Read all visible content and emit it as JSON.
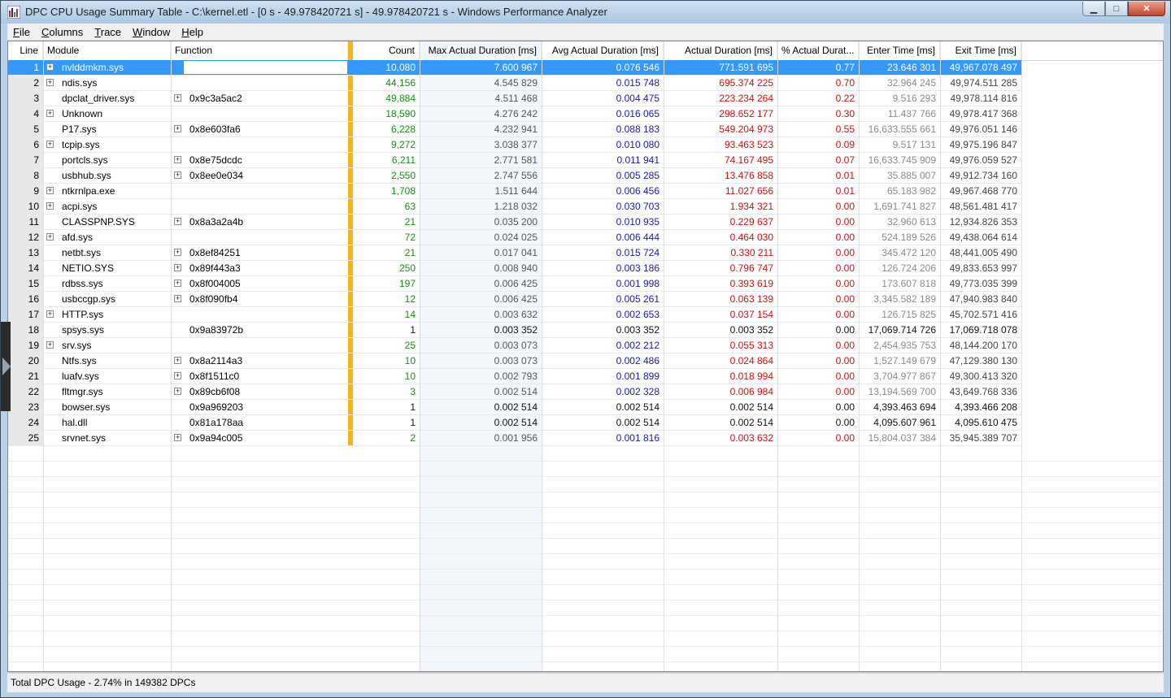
{
  "window": {
    "title": "DPC CPU Usage Summary Table - C:\\kernel.etl - [0 s - 49.978420721 s] - 49.978420721 s - Windows Performance Analyzer",
    "minimize_label": "▁",
    "maximize_label": "□",
    "close_label": "✕"
  },
  "menu": [
    {
      "label": "File",
      "accel": "F",
      "rest": "ile"
    },
    {
      "label": "Columns",
      "accel": "C",
      "rest": "olumns"
    },
    {
      "label": "Trace",
      "accel": "T",
      "rest": "race"
    },
    {
      "label": "Window",
      "accel": "W",
      "rest": "indow"
    },
    {
      "label": "Help",
      "accel": "H",
      "rest": "elp"
    }
  ],
  "columns": {
    "line": "Line",
    "module": "Module",
    "function": "Function",
    "count": "Count",
    "max": "Max Actual Duration [ms]",
    "avg": "Avg Actual Duration [ms]",
    "actual": "Actual Duration [ms]",
    "pct": "% Actual Durat...",
    "enter": "Enter Time [ms]",
    "exit": "Exit Time [ms]"
  },
  "rows": [
    {
      "line": "1",
      "module": "nvlddmkm.sys",
      "mexp": true,
      "func": "",
      "fexp": false,
      "count": "10,080",
      "max": "7.600 967",
      "avg": "0.076 546",
      "actual": "771.591 695",
      "pct": "0.77",
      "enter": "23.646 301",
      "exit": "49,967.078 497",
      "selected": true
    },
    {
      "line": "2",
      "module": "ndis.sys",
      "mexp": true,
      "func": "",
      "fexp": false,
      "count": "44,156",
      "max": "4.545 829",
      "avg": "0.015 748",
      "actual": "695.374 225",
      "pct": "0.70",
      "enter": "32.964 245",
      "exit": "49,974.511 285"
    },
    {
      "line": "3",
      "module": "dpclat_driver.sys",
      "mexp": false,
      "func": "0x9c3a5ac2",
      "fexp": true,
      "count": "49,884",
      "max": "4.511 468",
      "avg": "0.004 475",
      "actual": "223.234 264",
      "pct": "0.22",
      "enter": "9.516 293",
      "exit": "49,978.114 816"
    },
    {
      "line": "4",
      "module": "Unknown",
      "mexp": true,
      "func": "",
      "fexp": false,
      "count": "18,590",
      "max": "4.276 242",
      "avg": "0.016 065",
      "actual": "298.652 177",
      "pct": "0.30",
      "enter": "11.437 766",
      "exit": "49,978.417 368"
    },
    {
      "line": "5",
      "module": "P17.sys",
      "mexp": false,
      "func": "0x8e603fa6",
      "fexp": true,
      "count": "6,228",
      "max": "4.232 941",
      "avg": "0.088 183",
      "actual": "549.204 973",
      "pct": "0.55",
      "enter": "16,633.555 661",
      "exit": "49,976.051 146"
    },
    {
      "line": "6",
      "module": "tcpip.sys",
      "mexp": true,
      "func": "",
      "fexp": false,
      "count": "9,272",
      "max": "3.038 377",
      "avg": "0.010 080",
      "actual": "93.463 523",
      "pct": "0.09",
      "enter": "9.517 131",
      "exit": "49,975.196 847"
    },
    {
      "line": "7",
      "module": "portcls.sys",
      "mexp": false,
      "func": "0x8e75dcdc",
      "fexp": true,
      "count": "6,211",
      "max": "2.771 581",
      "avg": "0.011 941",
      "actual": "74.167 495",
      "pct": "0.07",
      "enter": "16,633.745 909",
      "exit": "49,976.059 527"
    },
    {
      "line": "8",
      "module": "usbhub.sys",
      "mexp": false,
      "func": "0x8ee0e034",
      "fexp": true,
      "count": "2,550",
      "max": "2.747 556",
      "avg": "0.005 285",
      "actual": "13.476 858",
      "pct": "0.01",
      "enter": "35.885 007",
      "exit": "49,912.734 160"
    },
    {
      "line": "9",
      "module": "ntkrnlpa.exe",
      "mexp": true,
      "func": "",
      "fexp": false,
      "count": "1,708",
      "max": "1.511 644",
      "avg": "0.006 456",
      "actual": "11.027 656",
      "pct": "0.01",
      "enter": "65.183 982",
      "exit": "49,967.468 770"
    },
    {
      "line": "10",
      "module": "acpi.sys",
      "mexp": true,
      "func": "",
      "fexp": false,
      "count": "63",
      "max": "1.218 032",
      "avg": "0.030 703",
      "actual": "1.934 321",
      "pct": "0.00",
      "enter": "1,691.741 827",
      "exit": "48,561.481 417"
    },
    {
      "line": "11",
      "module": "CLASSPNP.SYS",
      "mexp": false,
      "func": "0x8a3a2a4b",
      "fexp": true,
      "count": "21",
      "max": "0.035 200",
      "avg": "0.010 935",
      "actual": "0.229 637",
      "pct": "0.00",
      "enter": "32.960 613",
      "exit": "12,934.826 353"
    },
    {
      "line": "12",
      "module": "afd.sys",
      "mexp": true,
      "func": "",
      "fexp": false,
      "count": "72",
      "max": "0.024 025",
      "avg": "0.006 444",
      "actual": "0.464 030",
      "pct": "0.00",
      "enter": "524.189 526",
      "exit": "49,438.064 614"
    },
    {
      "line": "13",
      "module": "netbt.sys",
      "mexp": false,
      "func": "0x8ef84251",
      "fexp": true,
      "count": "21",
      "max": "0.017 041",
      "avg": "0.015 724",
      "actual": "0.330 211",
      "pct": "0.00",
      "enter": "345.472 120",
      "exit": "48,441.005 490"
    },
    {
      "line": "14",
      "module": "NETIO.SYS",
      "mexp": false,
      "func": "0x89f443a3",
      "fexp": true,
      "count": "250",
      "max": "0.008 940",
      "avg": "0.003 186",
      "actual": "0.796 747",
      "pct": "0.00",
      "enter": "126.724 206",
      "exit": "49,833.653 997"
    },
    {
      "line": "15",
      "module": "rdbss.sys",
      "mexp": false,
      "func": "0x8f004005",
      "fexp": true,
      "count": "197",
      "max": "0.006 425",
      "avg": "0.001 998",
      "actual": "0.393 619",
      "pct": "0.00",
      "enter": "173.607 818",
      "exit": "49,773.035 399"
    },
    {
      "line": "16",
      "module": "usbccgp.sys",
      "mexp": false,
      "func": "0x8f090fb4",
      "fexp": true,
      "count": "12",
      "max": "0.006 425",
      "avg": "0.005 261",
      "actual": "0.063 139",
      "pct": "0.00",
      "enter": "3,345.582 189",
      "exit": "47,940.983 840"
    },
    {
      "line": "17",
      "module": "HTTP.sys",
      "mexp": true,
      "func": "",
      "fexp": false,
      "count": "14",
      "max": "0.003 632",
      "avg": "0.002 653",
      "actual": "0.037 154",
      "pct": "0.00",
      "enter": "126.715 825",
      "exit": "45,702.571 416"
    },
    {
      "line": "18",
      "module": "spsys.sys",
      "mexp": false,
      "func": "0x9a83972b",
      "fexp": false,
      "count": "1",
      "max": "0.003 352",
      "avg": "0.003 352",
      "actual": "0.003 352",
      "pct": "0.00",
      "enter": "17,069.714 726",
      "exit": "17,069.718 078",
      "single": true
    },
    {
      "line": "19",
      "module": "srv.sys",
      "mexp": true,
      "func": "",
      "fexp": false,
      "count": "25",
      "max": "0.003 073",
      "avg": "0.002 212",
      "actual": "0.055 313",
      "pct": "0.00",
      "enter": "2,454.935 753",
      "exit": "48,144.200 170"
    },
    {
      "line": "20",
      "module": "Ntfs.sys",
      "mexp": false,
      "func": "0x8a2114a3",
      "fexp": true,
      "count": "10",
      "max": "0.003 073",
      "avg": "0.002 486",
      "actual": "0.024 864",
      "pct": "0.00",
      "enter": "1,527.149 679",
      "exit": "47,129.380 130"
    },
    {
      "line": "21",
      "module": "luafv.sys",
      "mexp": false,
      "func": "0x8f1511c0",
      "fexp": true,
      "count": "10",
      "max": "0.002 793",
      "avg": "0.001 899",
      "actual": "0.018 994",
      "pct": "0.00",
      "enter": "3,704.977 867",
      "exit": "49,300.413 320"
    },
    {
      "line": "22",
      "module": "fltmgr.sys",
      "mexp": false,
      "func": "0x89cb6f08",
      "fexp": true,
      "count": "3",
      "max": "0.002 514",
      "avg": "0.002 328",
      "actual": "0.006 984",
      "pct": "0.00",
      "enter": "13,194.569 700",
      "exit": "43,649.768 336"
    },
    {
      "line": "23",
      "module": "bowser.sys",
      "mexp": false,
      "func": "0x9a969203",
      "fexp": false,
      "count": "1",
      "max": "0.002 514",
      "avg": "0.002 514",
      "actual": "0.002 514",
      "pct": "0.00",
      "enter": "4,393.463 694",
      "exit": "4,393.466 208",
      "single": true
    },
    {
      "line": "24",
      "module": "hal.dll",
      "mexp": false,
      "func": "0x81a178aa",
      "fexp": false,
      "count": "1",
      "max": "0.002 514",
      "avg": "0.002 514",
      "actual": "0.002 514",
      "pct": "0.00",
      "enter": "4,095.607 961",
      "exit": "4,095.610 475",
      "single": true
    },
    {
      "line": "25",
      "module": "srvnet.sys",
      "mexp": false,
      "func": "0x9a94c005",
      "fexp": true,
      "count": "2",
      "max": "0.001 956",
      "avg": "0.001 816",
      "actual": "0.003 632",
      "pct": "0.00",
      "enter": "15,804.037 384",
      "exit": "35,945.389 707"
    }
  ],
  "status": "Total DPC Usage - 2.74% in 149382 DPCs",
  "colors": {
    "selection": "#3399ff",
    "count": "#1a8a1a",
    "avg": "#1a1aa8",
    "actual": "#cc1111",
    "divider": "#f4b41a"
  }
}
